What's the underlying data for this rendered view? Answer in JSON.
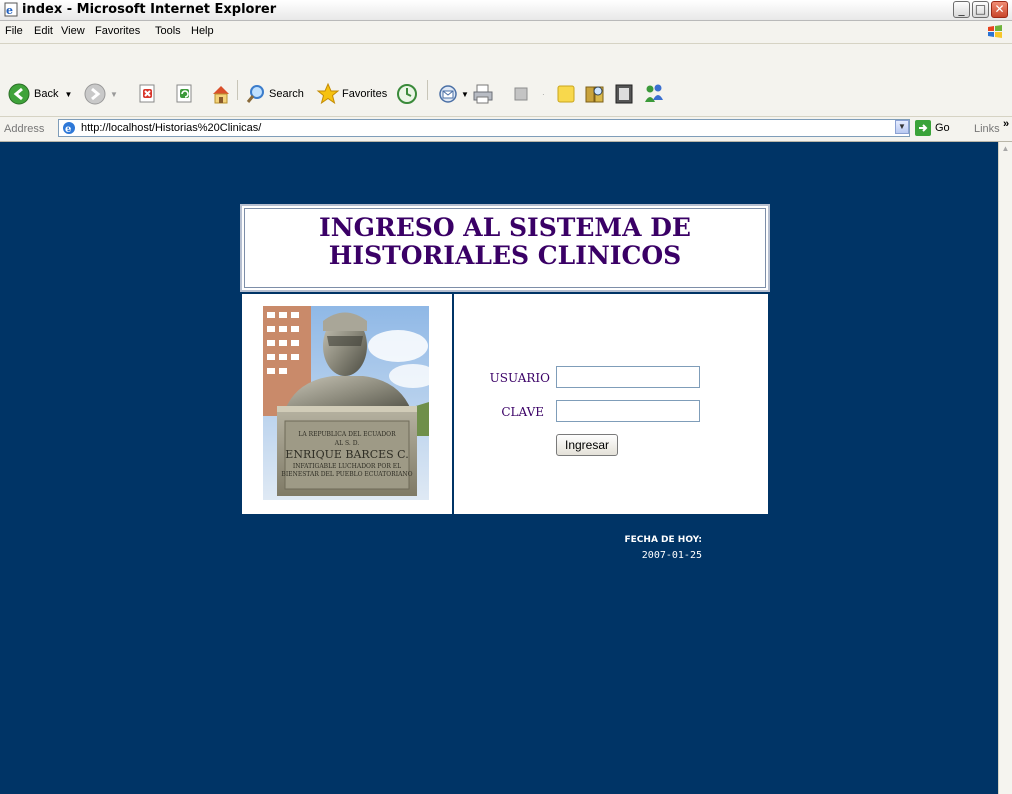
{
  "window": {
    "title": "index - Microsoft Internet Explorer"
  },
  "menu": [
    "File",
    "Edit",
    "View",
    "Favorites",
    "Tools",
    "Help"
  ],
  "toolbar": {
    "back": "Back",
    "search": "Search",
    "favorites": "Favorites"
  },
  "address": {
    "label": "Address",
    "url": "http://localhost/Historias%20Clinicas/",
    "go": "Go",
    "links": "Links"
  },
  "page": {
    "background": "#003466",
    "title_line1": "INGRESO AL SISTEMA DE",
    "title_line2": "HISTORIALES CLINICOS",
    "title_color": "#3a0066",
    "photo": {
      "plaque_line1": "LA REPUBLICA DEL ECUADOR",
      "plaque_line2": "AL S. D.",
      "plaque_line3": "ENRIQUE BARCES C.",
      "plaque_line4": "INFATIGABLE LUCHADOR POR EL",
      "plaque_line5": "BIENESTAR DEL PUEBLO ECUATORIANO"
    },
    "form": {
      "user_label": "USUARIO",
      "user_value": "",
      "pass_label": "CLAVE",
      "pass_value": "",
      "submit_label": "Ingresar"
    },
    "date_label": "FECHA DE HOY:",
    "date_value": "2007-01-25"
  }
}
